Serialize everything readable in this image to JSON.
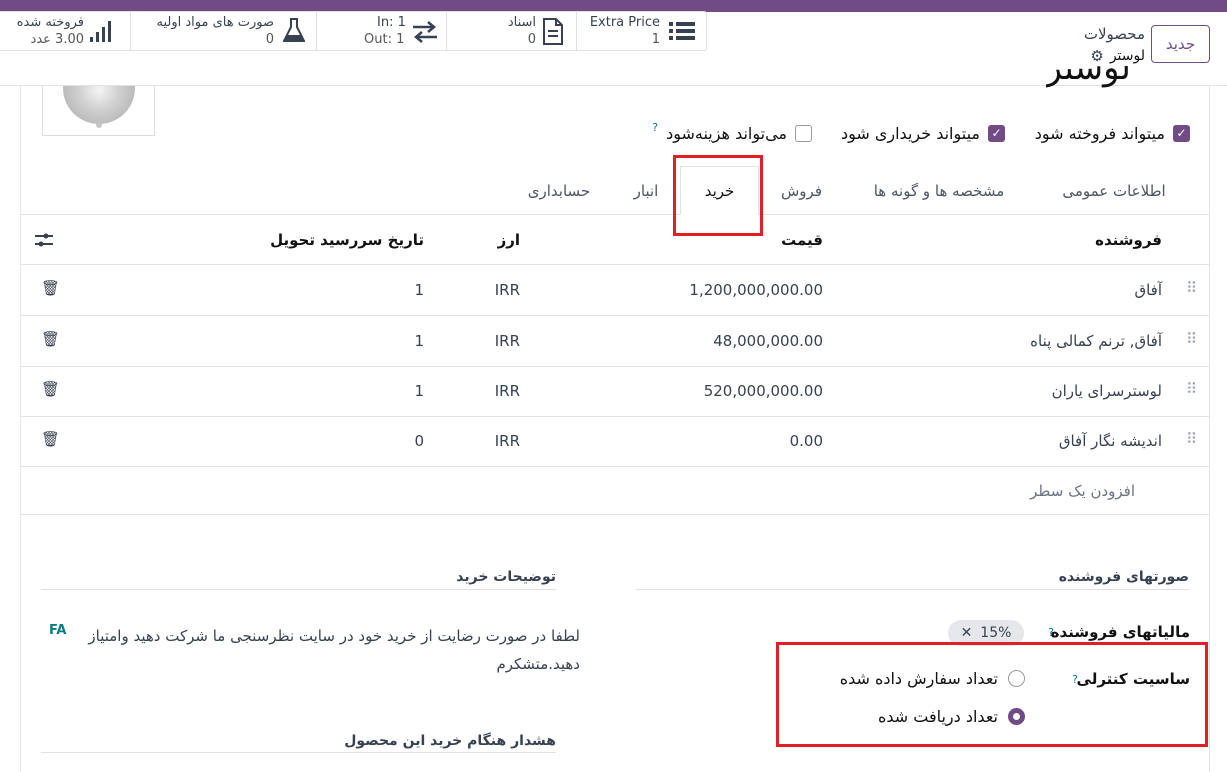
{
  "header": {
    "new_button": "جدید",
    "breadcrumb_parent": "محصولات",
    "breadcrumb_current": "لوستر",
    "stats": [
      {
        "label": "Extra Price",
        "value": "1",
        "icon": "list-icon"
      },
      {
        "label": "اسناد",
        "value": "0",
        "icon": "document-icon"
      },
      {
        "label": "In: 1",
        "value": "Out: 1",
        "icon": "transfer-arrows-icon"
      },
      {
        "label": "صورت های مواد اولیه",
        "value": "0",
        "icon": "flask-icon"
      },
      {
        "label": "فروخته شده",
        "value": "3.00 عدد",
        "icon": "bar-chart-icon"
      }
    ]
  },
  "product": {
    "title_fragment": "لوستر",
    "checkboxes": [
      {
        "label": "میتواند فروخته شود",
        "checked": true
      },
      {
        "label": "میتواند خریداری شود",
        "checked": true
      },
      {
        "label": "می‌تواند هزینه‌شود",
        "checked": false,
        "help": "?"
      }
    ]
  },
  "tabs": [
    {
      "label": "اطلاعات عمومی",
      "active": false
    },
    {
      "label": "مشخصه ها و گونه ها",
      "active": false
    },
    {
      "label": "فروش",
      "active": false
    },
    {
      "label": "خرید",
      "active": true
    },
    {
      "label": "انبار",
      "active": false
    },
    {
      "label": "حسابداری",
      "active": false
    }
  ],
  "vendor_table": {
    "columns": [
      "فروشنده",
      "قیمت",
      "ارز",
      "تاریخ سررسید تحویل"
    ],
    "rows": [
      {
        "vendor": "آفاق",
        "price": "1,200,000,000.00",
        "currency": "IRR",
        "lead_time": "1"
      },
      {
        "vendor": "آفاق, ترنم کمالی پناه",
        "price": "48,000,000.00",
        "currency": "IRR",
        "lead_time": "1"
      },
      {
        "vendor": "لوسترسرای یاران",
        "price": "520,000,000.00",
        "currency": "IRR",
        "lead_time": "1"
      },
      {
        "vendor": "اندیشه نگار آفاق",
        "price": "0.00",
        "currency": "IRR",
        "lead_time": "0"
      }
    ],
    "add_line": "افزودن یک سطر"
  },
  "vendor_bills": {
    "section_title": "صورتهای فروشنده",
    "taxes_label": "مالیاتهای فروشنده",
    "taxes_help": "?",
    "tax_badge": "15%",
    "control_policy_label": "ساسیت کنترلی",
    "control_policy_help": "?",
    "options": [
      {
        "label": "تعداد سفارش داده شده",
        "selected": false
      },
      {
        "label": "تعداد دریافت شده",
        "selected": true
      }
    ]
  },
  "purchase_description": {
    "section_title": "توضیحات خرید",
    "text": "لطفا در صورت رضایت از خرید خود در سایت نظرسنجی ما  شرکت دهید وامتیاز دهید.متشکرم",
    "lang_tag": "FA"
  },
  "purchase_warning": {
    "section_title": "هشدار هنگام خرید این محصول"
  },
  "colors": {
    "brand": "#714b86",
    "highlight_box": "#e21e26",
    "help": "#017e84"
  }
}
